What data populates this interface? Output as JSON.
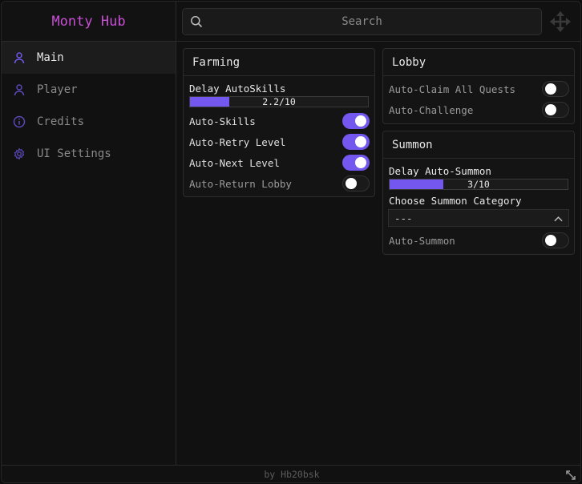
{
  "app": {
    "title": "Monty Hub",
    "footer": "by Hb20bsk"
  },
  "colors": {
    "accent": "#7457ee",
    "brand": "#c94fd6"
  },
  "sidebar": {
    "items": [
      {
        "label": "Main",
        "icon": "user-icon",
        "active": true
      },
      {
        "label": "Player",
        "icon": "user-icon",
        "active": false
      },
      {
        "label": "Credits",
        "icon": "info-icon",
        "active": false
      },
      {
        "label": "UI Settings",
        "icon": "gear-icon",
        "active": false
      }
    ]
  },
  "search": {
    "placeholder": "Search",
    "value": ""
  },
  "farming": {
    "title": "Farming",
    "delay_label": "Delay AutoSkills",
    "delay_value": 2.2,
    "delay_max": 10,
    "delay_text": "2.2/10",
    "toggles": [
      {
        "label": "Auto-Skills",
        "on": true
      },
      {
        "label": "Auto-Retry Level",
        "on": true
      },
      {
        "label": "Auto-Next Level",
        "on": true
      },
      {
        "label": "Auto-Return Lobby",
        "on": false
      }
    ]
  },
  "lobby": {
    "title": "Lobby",
    "toggles": [
      {
        "label": "Auto-Claim All Quests",
        "on": false
      },
      {
        "label": "Auto-Challenge",
        "on": false
      }
    ]
  },
  "summon": {
    "title": "Summon",
    "delay_label": "Delay Auto-Summon",
    "delay_value": 3,
    "delay_max": 10,
    "delay_text": "3/10",
    "category_label": "Choose Summon Category",
    "category_value": "---",
    "toggles": [
      {
        "label": "Auto-Summon",
        "on": false
      }
    ]
  }
}
